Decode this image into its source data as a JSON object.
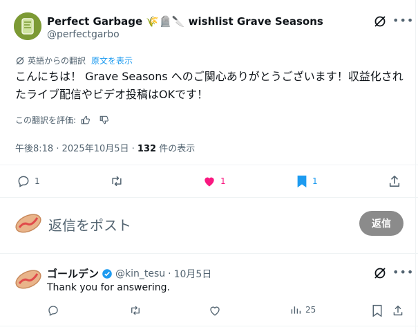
{
  "tweet": {
    "author_name": "Perfect Garbage",
    "author_emoji": "🌾🪦🔪",
    "author_title": "wishlist Grave Seasons",
    "author_handle": "@perfectgarbo",
    "translated_label": "英語からの翻訳",
    "show_original": "原文を表示",
    "text": "こんにちは！ Grave Seasons へのご関心ありがとうございます！収益化されたライブ配信やビデオ投稿はOKです！",
    "rate_translation": "この翻訳を評価:",
    "time": "午後8:18",
    "date": "2025年10月5日",
    "views_count": "132",
    "views_label": "件の表示",
    "reply_count": "1",
    "retweet_count": "",
    "like_count": "1",
    "bookmark_count": "1"
  },
  "composer": {
    "placeholder": "返信をポスト",
    "reply_button": "返信"
  },
  "reply": {
    "author_name": "ゴールデン",
    "author_handle": "@kin_tesu",
    "date": "10月5日",
    "text": "Thank you for answering.",
    "views_count": "25"
  },
  "colors": {
    "like": "#f91880",
    "accent": "#1d9bf0",
    "verified": "#1d9bf0",
    "muted": "#536471"
  }
}
